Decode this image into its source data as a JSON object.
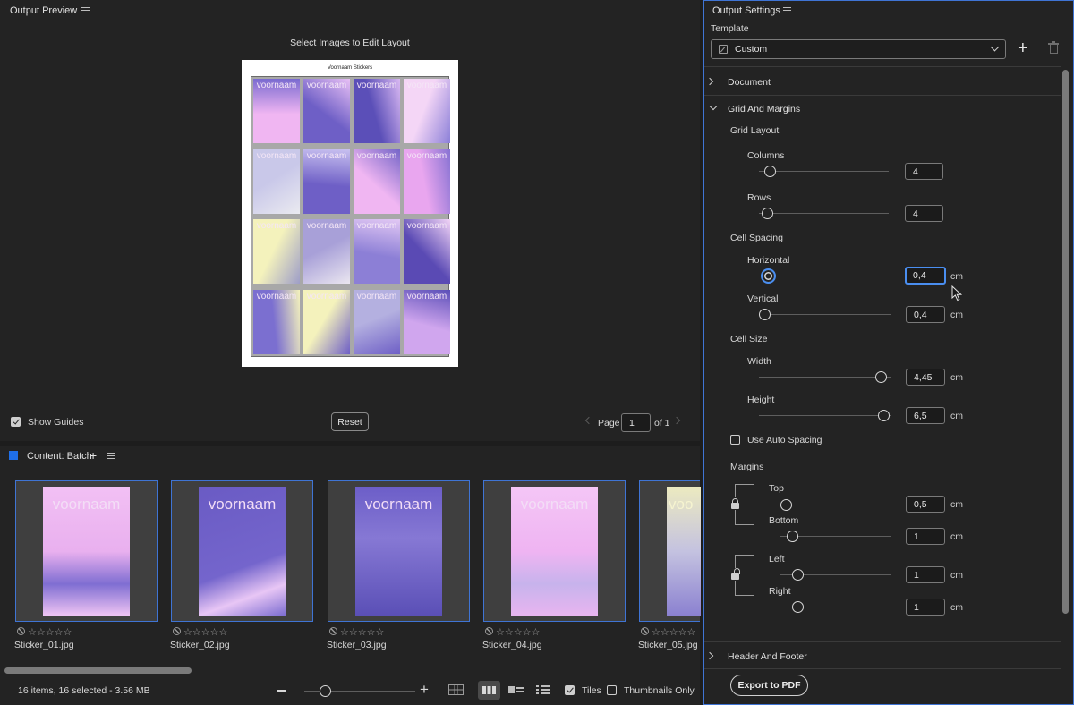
{
  "preview": {
    "title": "Output Preview",
    "instruction": "Select Images to Edit Layout",
    "doc_title": "Voornaam Stickers",
    "cell_text": "voornaam",
    "show_guides_label": "Show Guides",
    "show_guides_checked": true,
    "reset_label": "Reset",
    "page_label": "Page",
    "page_value": "1",
    "page_of": "of 1"
  },
  "content": {
    "title": "Content: Batch",
    "items": [
      {
        "file": "Sticker_01.jpg",
        "text": "voornaam",
        "stars": "☆☆☆☆☆"
      },
      {
        "file": "Sticker_02.jpg",
        "text": "voornaam",
        "stars": "☆☆☆☆☆"
      },
      {
        "file": "Sticker_03.jpg",
        "text": "voornaam",
        "stars": "☆☆☆☆☆"
      },
      {
        "file": "Sticker_04.jpg",
        "text": "voornaam",
        "stars": "☆☆☆☆☆"
      },
      {
        "file": "Sticker_05.jpg",
        "text": "voo",
        "stars": "☆☆☆☆☆"
      }
    ],
    "status": "16 items, 16 selected - 3.56 MB",
    "tiles_label": "Tiles",
    "tiles_checked": true,
    "thumbnails_only_label": "Thumbnails Only",
    "thumbnails_only_checked": false
  },
  "settings": {
    "title": "Output Settings",
    "template_label": "Template",
    "template_value": "Custom",
    "document_label": "Document",
    "grid_margins_label": "Grid And Margins",
    "grid_layout_label": "Grid Layout",
    "columns_label": "Columns",
    "columns_value": "4",
    "rows_label": "Rows",
    "rows_value": "4",
    "cell_spacing_label": "Cell Spacing",
    "horizontal_label": "Horizontal",
    "horizontal_value": "0,4",
    "vertical_label": "Vertical",
    "vertical_value": "0,4",
    "cell_size_label": "Cell Size",
    "width_label": "Width",
    "width_value": "4,45",
    "height_label": "Height",
    "height_value": "6,5",
    "auto_spacing_label": "Use Auto Spacing",
    "auto_spacing_checked": false,
    "margins_label": "Margins",
    "top_label": "Top",
    "top_value": "0,5",
    "bottom_label": "Bottom",
    "bottom_value": "1",
    "left_label": "Left",
    "left_value": "1",
    "right_label": "Right",
    "right_value": "1",
    "unit": "cm",
    "header_footer_label": "Header And Footer",
    "export_label": "Export to PDF"
  },
  "colors": {
    "accent_blue": "#3f74d4",
    "focus_blue": "#4a8ef0",
    "panel_bg": "#232323",
    "sticker_pink": "#f0b6f2",
    "sticker_purple": "#6e5fc6",
    "sticker_yellow": "#f4f2bc"
  },
  "icons": [
    "hamburger-menu-icon",
    "pencil-icon",
    "chevron-down-icon",
    "plus-icon",
    "trash-icon",
    "chevron-right-icon",
    "lock-icon",
    "reject-flag-icon",
    "star-icon",
    "grid-view-icon",
    "list-view-icon",
    "details-view-icon",
    "zoom-minus-icon",
    "zoom-plus-icon",
    "mouse-cursor-icon"
  ]
}
